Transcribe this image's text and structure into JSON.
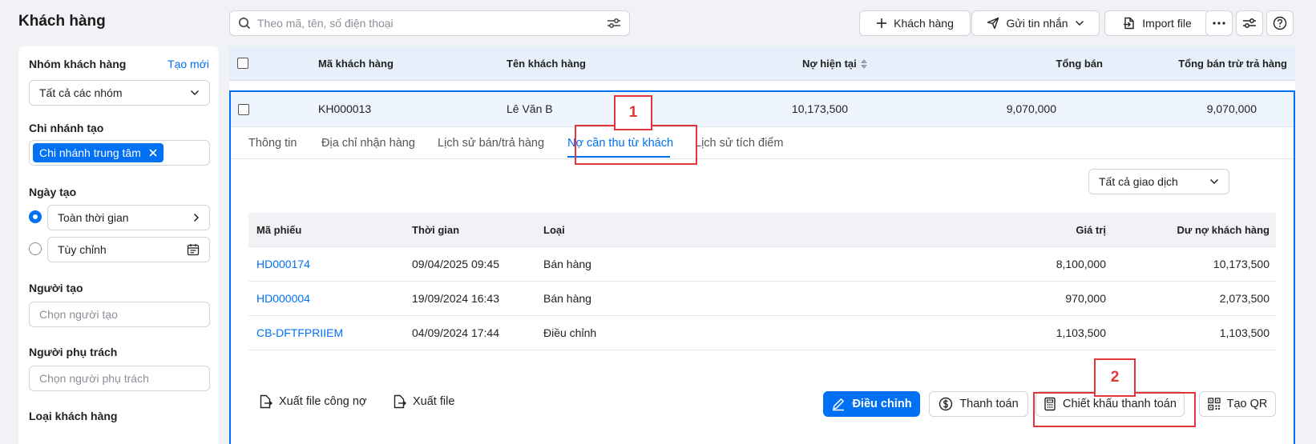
{
  "header": {
    "title": "Khách hàng",
    "search_placeholder": "Theo mã, tên, số điện thoại",
    "add_customer_label": "Khách hàng",
    "send_message_label": "Gửi tin nhắn",
    "import_label": "Import file"
  },
  "sidebar": {
    "group_label": "Nhóm khách hàng",
    "group_create_link": "Tạo mới",
    "group_value": "Tất cả các nhóm",
    "branch_label": "Chi nhánh tạo",
    "branch_tag": "Chi nhánh trung tâm",
    "date_label": "Ngày tạo",
    "date_all_time": "Toàn thời gian",
    "date_custom": "Tùy chỉnh",
    "creator_label": "Người tạo",
    "creator_placeholder": "Chọn người tạo",
    "manager_label": "Người phụ trách",
    "manager_placeholder": "Chọn người phụ trách",
    "type_label": "Loại khách hàng"
  },
  "table": {
    "columns": [
      "Mã khách hàng",
      "Tên khách hàng",
      "Nợ hiện tại",
      "Tổng bán",
      "Tổng bán trừ trả hàng"
    ],
    "row": {
      "code": "KH000013",
      "name": "Lê Văn B",
      "debt": "10,173,500",
      "total_sales": "9,070,000",
      "net_sales": "9,070,000"
    }
  },
  "detail": {
    "tabs": [
      "Thông tin",
      "Địa chỉ nhận hàng",
      "Lịch sử bán/trả hàng",
      "Nợ cần thu từ khách",
      "Lịch sử tích điểm"
    ],
    "active_tab": "Nợ cần thu từ khách",
    "filter_value": "Tất cả giao dịch",
    "columns": [
      "Mã phiếu",
      "Thời gian",
      "Loại",
      "Giá trị",
      "Dư nợ khách hàng"
    ],
    "rows": [
      {
        "code": "HD000174",
        "time": "09/04/2025 09:45",
        "type": "Bán hàng",
        "value": "8,100,000",
        "balance": "10,173,500"
      },
      {
        "code": "HD000004",
        "time": "19/09/2024 16:43",
        "type": "Bán hàng",
        "value": "970,000",
        "balance": "2,073,500"
      },
      {
        "code": "CB-DFTFPRIIEM",
        "time": "04/09/2024 17:44",
        "type": "Điều chỉnh",
        "value": "1,103,500",
        "balance": "1,103,500"
      }
    ],
    "export_debt_label": "Xuất file công nợ",
    "export_file_label": "Xuất file",
    "adjust_label": "Điều chỉnh",
    "payment_label": "Thanh toán",
    "discount_label": "Chiết khấu thanh toán",
    "qr_label": "Tạo QR"
  },
  "annotations": {
    "callout_1": "1",
    "callout_2": "2"
  },
  "colors": {
    "accent": "#0070f4",
    "callout": "#e2363b",
    "header_bg": "#e6effa"
  }
}
